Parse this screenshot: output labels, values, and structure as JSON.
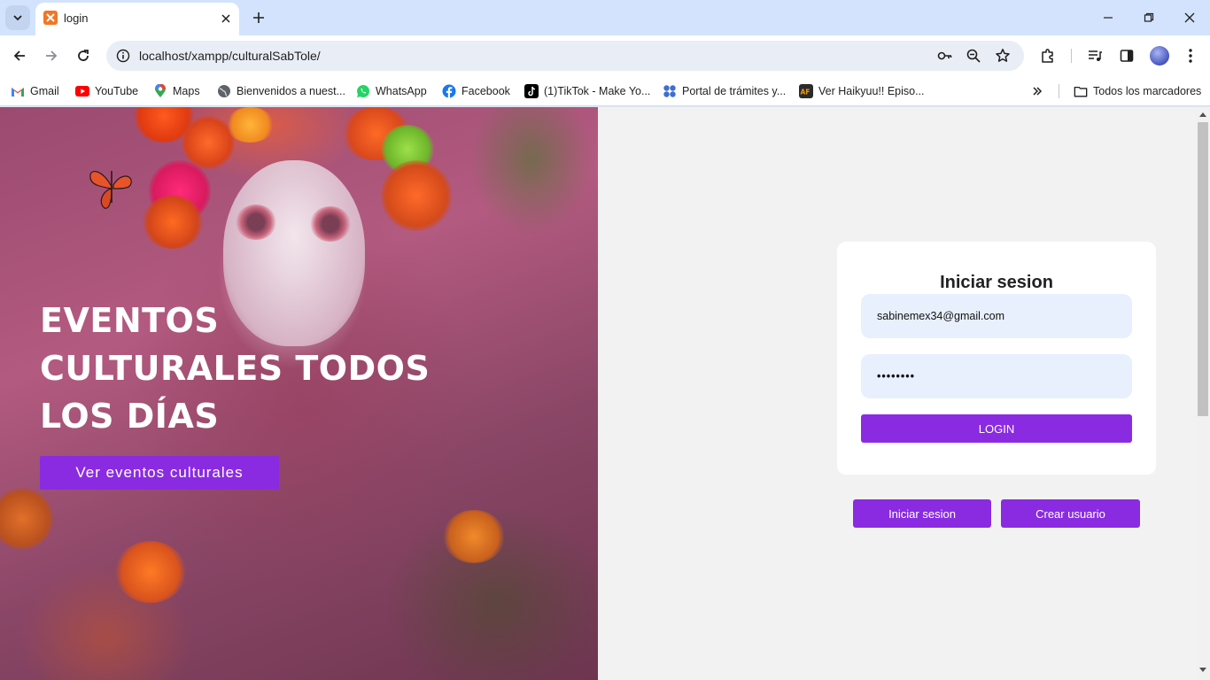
{
  "browser": {
    "tab": {
      "title": "login"
    },
    "url": "localhost/xampp/culturalSabTole/",
    "bookmarks": [
      {
        "label": "Gmail",
        "icon": "gmail-icon"
      },
      {
        "label": "YouTube",
        "icon": "youtube-icon"
      },
      {
        "label": "Maps",
        "icon": "maps-icon"
      },
      {
        "label": "Bienvenidos a nuest...",
        "icon": "globe-icon"
      },
      {
        "label": "WhatsApp",
        "icon": "whatsapp-icon"
      },
      {
        "label": "Facebook",
        "icon": "facebook-icon"
      },
      {
        "label": "(1)TikTok - Make Yo...",
        "icon": "tiktok-icon"
      },
      {
        "label": "Portal de trámites y...",
        "icon": "portal-icon"
      },
      {
        "label": "Ver Haikyuu!! Episo...",
        "icon": "animeflv-icon"
      }
    ],
    "all_bookmarks_label": "Todos los marcadores"
  },
  "hero": {
    "title_lines": [
      "EVENTOS",
      "CULTURALES TODOS",
      "LOS DÍAS"
    ],
    "button_label": "Ver eventos culturales"
  },
  "login": {
    "title": "Iniciar sesion",
    "email_value": "sabinemex34@gmail.com",
    "password_value": "••••••••",
    "login_label": "LOGIN"
  },
  "actions": {
    "signin_label": "Iniciar sesion",
    "create_user_label": "Crear usuario"
  },
  "colors": {
    "accent": "#8a2be2",
    "input_bg": "#e8f0fe",
    "tabstrip": "#d3e3fd"
  }
}
